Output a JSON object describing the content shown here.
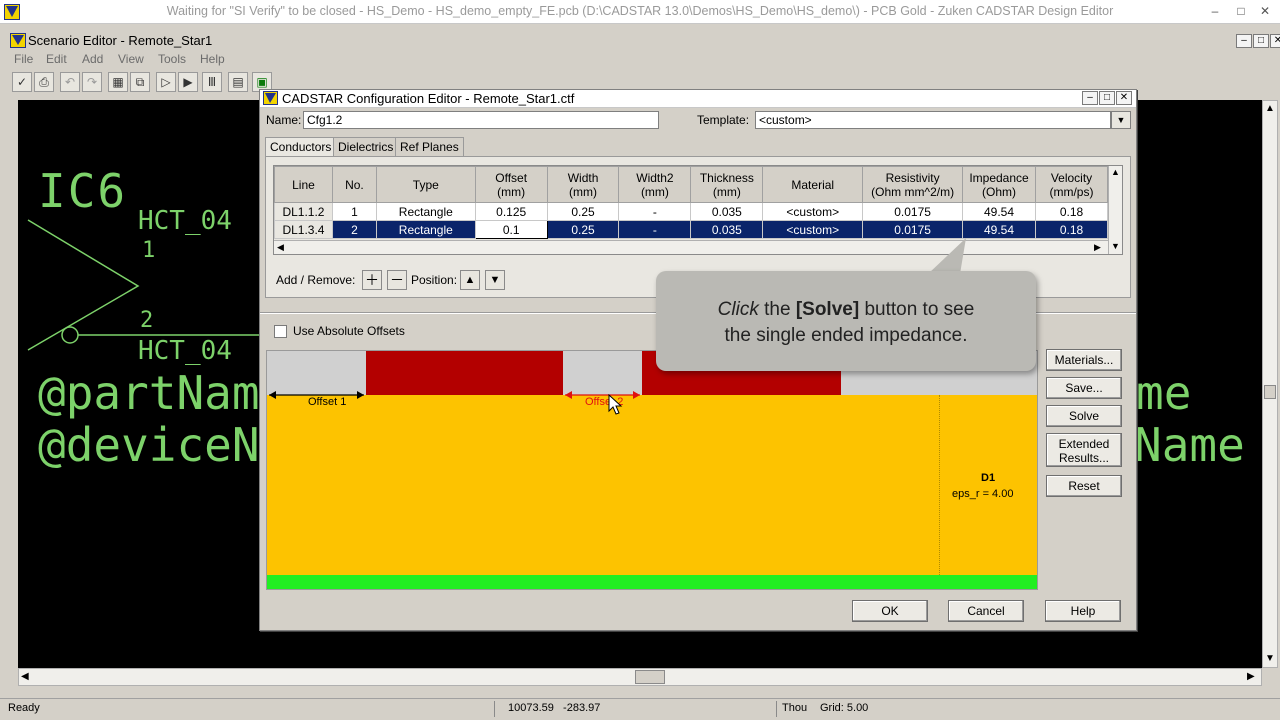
{
  "app": {
    "title": "Waiting for \"SI Verify\" to be closed - HS_Demo - HS_demo_empty_FE.pcb (D:\\CADSTAR 13.0\\Demos\\HS_Demo\\HS_demo\\) - PCB Gold - Zuken CADSTAR Design Editor"
  },
  "scenario": {
    "title": "Scenario Editor - Remote_Star1",
    "menu": [
      "File",
      "Edit",
      "Add",
      "View",
      "Tools",
      "Help"
    ]
  },
  "pcb": {
    "ref": "IC6",
    "part_top": "HCT_04",
    "pin1": "1",
    "pin2": "2",
    "part_bottom": "HCT_04",
    "part_name": "@partName",
    "device_name": "@deviceName",
    "right_me": "me",
    "right_name": "Name"
  },
  "dialog": {
    "title": "CADSTAR Configuration Editor - Remote_Star1.ctf",
    "name_label": "Name:",
    "name_value": "Cfg1.2",
    "template_label": "Template:",
    "template_value": "<custom>",
    "tabs": [
      "Conductors",
      "Dielectrics",
      "Ref Planes"
    ],
    "columns": [
      "Line",
      "No.",
      "Type",
      "Offset (mm)",
      "Width (mm)",
      "Width2 (mm)",
      "Thickness (mm)",
      "Material",
      "Resistivity (Ohm mm^2/m)",
      "Impedance (Ohm)",
      "Velocity (mm/ps)"
    ],
    "col_head": {
      "line": "Line",
      "no": "No.",
      "type": "Type",
      "offset": "Offset",
      "offset_u": "(mm)",
      "width": "Width",
      "width_u": "(mm)",
      "width2": "Width2",
      "width2_u": "(mm)",
      "thick": "Thickness",
      "thick_u": "(mm)",
      "material": "Material",
      "resist": "Resistivity",
      "resist_u": "(Ohm mm^2/m)",
      "imped": "Impedance",
      "imped_u": "(Ohm)",
      "vel": "Velocity",
      "vel_u": "(mm/ps)"
    },
    "rows": [
      {
        "line": "DL1.1.2",
        "no": "1",
        "type": "Rectangle",
        "offset": "0.125",
        "width": "0.25",
        "width2": "-",
        "thickness": "0.035",
        "material": "<custom>",
        "resistivity": "0.0175",
        "impedance": "49.54",
        "velocity": "0.18"
      },
      {
        "line": "DL1.3.4",
        "no": "2",
        "type": "Rectangle",
        "offset": "0.1",
        "width": "0.25",
        "width2": "-",
        "thickness": "0.035",
        "material": "<custom>",
        "resistivity": "0.0175",
        "impedance": "49.54",
        "velocity": "0.18"
      }
    ],
    "add_remove_label": "Add / Remove:",
    "position_label": "Position:",
    "absolute_offsets_label": "Use Absolute Offsets",
    "absolute_offsets_checked": false,
    "offset1_label": "Offset 1",
    "offset2_label": "Offset 2",
    "dielectric_name": "D1",
    "dielectric_eps": "eps_r = 4.00",
    "side_buttons": [
      "Materials...",
      "Save...",
      "Solve",
      "Extended Results...",
      "Reset"
    ],
    "extended_line1": "Extended",
    "extended_line2": "Results...",
    "ok": "OK",
    "cancel": "Cancel",
    "help": "Help"
  },
  "callout": {
    "click": "Click",
    "the": " the ",
    "solve": "[Solve]",
    "rest1": " button to see",
    "rest2": "the single ended impedance."
  },
  "status": {
    "ready": "Ready",
    "coords": "10073.59   -283.97",
    "units": "Thou",
    "grid": "Grid: 5.00"
  },
  "colors": {
    "dielectric": "#fdc300",
    "conductor": "#b30000",
    "ground_plane": "#22ee22",
    "pcb_text": "#7dd26a",
    "selection": "#0a246a"
  }
}
